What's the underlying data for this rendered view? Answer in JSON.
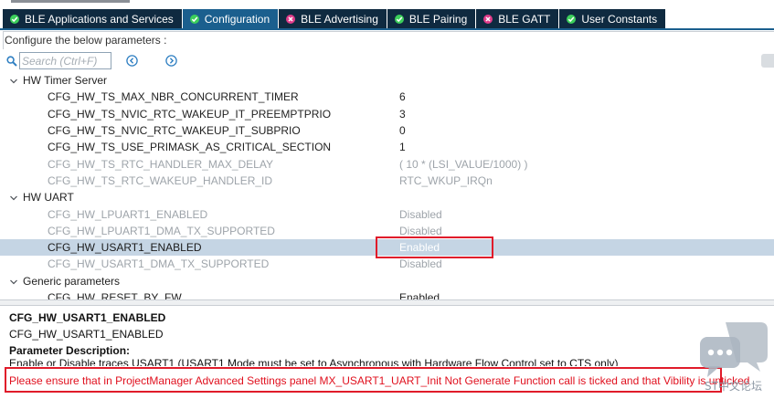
{
  "tabs": [
    {
      "label": "BLE Applications and Services",
      "status": "ok",
      "active": false
    },
    {
      "label": "Configuration",
      "status": "ok",
      "active": true
    },
    {
      "label": "BLE Advertising",
      "status": "error",
      "active": false
    },
    {
      "label": "BLE Pairing",
      "status": "ok",
      "active": false
    },
    {
      "label": "BLE GATT",
      "status": "error",
      "active": false
    },
    {
      "label": "User Constants",
      "status": "ok",
      "active": false
    }
  ],
  "header": {
    "label": "Configure the below parameters :"
  },
  "search": {
    "placeholder": "Search (Ctrl+F)",
    "value": ""
  },
  "tree": {
    "groups": [
      {
        "name": "HW Timer Server",
        "params": [
          {
            "name": "CFG_HW_TS_MAX_NBR_CONCURRENT_TIMER",
            "value": "6",
            "editable": true
          },
          {
            "name": "CFG_HW_TS_NVIC_RTC_WAKEUP_IT_PREEMPTPRIO",
            "value": "3",
            "editable": true
          },
          {
            "name": "CFG_HW_TS_NVIC_RTC_WAKEUP_IT_SUBPRIO",
            "value": "0",
            "editable": true
          },
          {
            "name": "CFG_HW_TS_USE_PRIMASK_AS_CRITICAL_SECTION",
            "value": "1",
            "editable": true
          },
          {
            "name": "CFG_HW_TS_RTC_HANDLER_MAX_DELAY",
            "value": "( 10 * (LSI_VALUE/1000) )",
            "editable": false
          },
          {
            "name": "CFG_HW_TS_RTC_WAKEUP_HANDLER_ID",
            "value": "RTC_WKUP_IRQn",
            "editable": false
          }
        ]
      },
      {
        "name": "HW UART",
        "params": [
          {
            "name": "CFG_HW_LPUART1_ENABLED",
            "value": "Disabled",
            "editable": false
          },
          {
            "name": "CFG_HW_LPUART1_DMA_TX_SUPPORTED",
            "value": "Disabled",
            "editable": false
          },
          {
            "name": "CFG_HW_USART1_ENABLED",
            "value": "Enabled",
            "editable": true,
            "selected": true
          },
          {
            "name": "CFG_HW_USART1_DMA_TX_SUPPORTED",
            "value": "Disabled",
            "editable": false
          }
        ]
      },
      {
        "name": "Generic parameters",
        "params": [
          {
            "name": "CFG_HW_RESET_BY_FW",
            "value": "Enabled",
            "editable": true
          }
        ]
      }
    ]
  },
  "description": {
    "title": "CFG_HW_USART1_ENABLED",
    "subtitle": "CFG_HW_USART1_ENABLED",
    "section_heading": "Parameter Description:",
    "text": "Enable or Disable traces USART1 (USART1 Mode must be set to Asynchronous with Hardware Flow Control set to CTS only)",
    "warning": "Please ensure that in ProjectManager Advanced Settings panel MX_USART1_UART_Init Not Generate Function call is ticked and that Vibility is unticked"
  },
  "watermark": {
    "text": "ST中文论坛"
  },
  "colors": {
    "tab_bg": "#0f2a40",
    "tab_active_bg": "#1b5f8e",
    "status_ok": "#3ccf5b",
    "status_error": "#e03c8a",
    "selected_row": "#c5d5e4",
    "highlight_red": "#e01b2a",
    "warning_text": "#e0101e"
  }
}
